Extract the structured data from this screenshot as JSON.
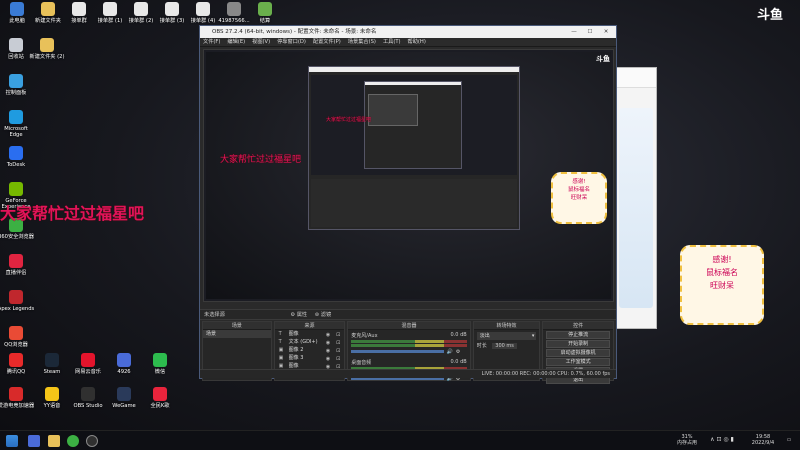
{
  "desktop_top": [
    {
      "label": "此电脑",
      "color": "#3a7bd5"
    },
    {
      "label": "新建文件夹",
      "color": "#e8c15a"
    },
    {
      "label": "接单群",
      "color": "#e8e8e8"
    },
    {
      "label": "接单群 (1)",
      "color": "#e8e8e8"
    },
    {
      "label": "接单群 (2)",
      "color": "#e8e8e8"
    },
    {
      "label": "接单群 (3)",
      "color": "#e8e8e8"
    },
    {
      "label": "接单群 (4)",
      "color": "#e8e8e8"
    },
    {
      "label": "41987566...",
      "color": "#888"
    },
    {
      "label": "结算",
      "color": "#6ab04c"
    }
  ],
  "desktop_left": [
    {
      "label": "回收站",
      "color": "#c8ccd4"
    },
    {
      "label": "控制面板",
      "color": "#3aa0e0"
    },
    {
      "label": "Microsoft Edge",
      "color": "#1f9be0"
    },
    {
      "label": "ToDesk",
      "color": "#2a6ef0"
    },
    {
      "label": "GeForce Experience",
      "color": "#76b900"
    },
    {
      "label": "360安全浏览器",
      "color": "#3cb043"
    },
    {
      "label": "直播伴侣",
      "color": "#e02440"
    },
    {
      "label": "Apex Legends",
      "color": "#c0272d"
    },
    {
      "label": "QQ浏览器",
      "color": "#e94b35"
    }
  ],
  "desktop_mid": {
    "label": "新建文件夹 (2)",
    "color": "#e8c15a"
  },
  "desktop_bottom1": [
    {
      "label": "腾讯QQ",
      "color": "#e82a2a"
    },
    {
      "label": "Steam",
      "color": "#1b2838"
    },
    {
      "label": "网易云音乐",
      "color": "#e4142c"
    },
    {
      "label": "4926",
      "color": "#4a6bd8"
    },
    {
      "label": "微信",
      "color": "#2dbc4e"
    }
  ],
  "desktop_bottom2": [
    {
      "label": "爱游电竞加速器",
      "color": "#d82a2a"
    },
    {
      "label": "YY语音",
      "color": "#f5c518"
    },
    {
      "label": "OBS Studio",
      "color": "#303030"
    },
    {
      "label": "WeGame",
      "color": "#2a3a5a"
    },
    {
      "label": "全民K歌",
      "color": "#e8243c"
    }
  ],
  "obs": {
    "title": "OBS 27.2.4 (64-bit, windows) - 配置文件: 未命名 - 场景: 未命名",
    "menu": [
      "文件(F)",
      "编辑(E)",
      "视图(V)",
      "停靠窗口(D)",
      "配置文件(P)",
      "场景集合(S)",
      "工具(T)",
      "帮助(H)"
    ],
    "no_source": "未选择源",
    "properties": "属性",
    "filters": "滤镜",
    "docks": {
      "scenes": "场景",
      "sources": "来源",
      "mixer": "混音器",
      "transitions": "转场特效",
      "controls": "控件"
    },
    "scene_item": "场景",
    "sources": [
      {
        "type": "T",
        "name": "图像"
      },
      {
        "type": "T",
        "name": "文本 (GDI+)"
      },
      {
        "type": "▣",
        "name": "图像 2"
      },
      {
        "type": "▣",
        "name": "图像 3"
      },
      {
        "type": "▣",
        "name": "图像"
      },
      {
        "type": "▣",
        "name": "显示器采集"
      }
    ],
    "mixer": [
      {
        "name": "麦克风/Aux",
        "db": "0.0 dB"
      },
      {
        "name": "桌面音频",
        "db": "0.0 dB"
      }
    ],
    "transition": {
      "value": "淡出",
      "duration_label": "时长",
      "duration": "300 ms"
    },
    "controls": [
      "停止推流",
      "开始录制",
      "启动虚拟摄像机",
      "工作室模式",
      "设置",
      "退出"
    ],
    "status": "LIVE: 00:00:00    REC: 00:00:00    CPU: 0.7%, 60.00 fps"
  },
  "danmu": [
    {
      "text": "大家帮忙过过福星吧"
    },
    {
      "text": "大家帮忙过过福星吧"
    },
    {
      "text": "大家帮忙过过福星吧"
    }
  ],
  "sticker": {
    "line1": "感谢!",
    "line2": "鼠标福名",
    "line3": "旺财呆"
  },
  "logo": "斗鱼",
  "tray": {
    "battery": "31%",
    "battery_label": "内存占用",
    "time": "19:58",
    "date": "2022/9/4"
  }
}
